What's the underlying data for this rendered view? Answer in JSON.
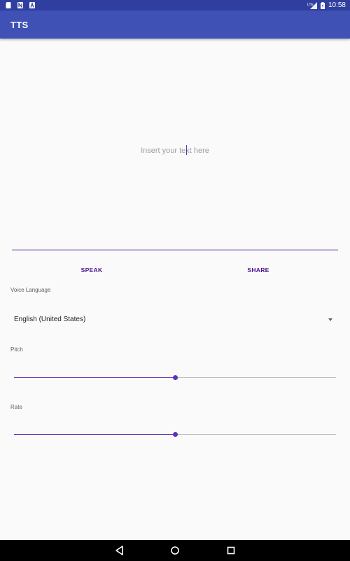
{
  "status_bar": {
    "time": "10:58",
    "network_label": "LTE",
    "left_icons": [
      "sim-card-icon",
      "notification-n-icon",
      "notification-a-icon"
    ],
    "right_icons": [
      "signal-icon",
      "battery-icon"
    ]
  },
  "app_bar": {
    "title": "TTS"
  },
  "text_input": {
    "placeholder": "Insert your text here",
    "value": ""
  },
  "buttons": {
    "speak": "SPEAK",
    "share": "SHARE"
  },
  "voice_language": {
    "label": "Voice Language",
    "selected": "English (United States)"
  },
  "pitch": {
    "label": "Pitch",
    "value_fraction": 0.5
  },
  "rate": {
    "label": "Rate",
    "value_fraction": 0.5
  },
  "nav_bar": {
    "icons": [
      "back-icon",
      "home-icon",
      "recents-icon"
    ]
  },
  "colors": {
    "primary": "#3f51b5",
    "primary_dark": "#303f9f",
    "accent": "#5e35b1",
    "button_text": "#4a148c",
    "background": "#fafafa"
  }
}
